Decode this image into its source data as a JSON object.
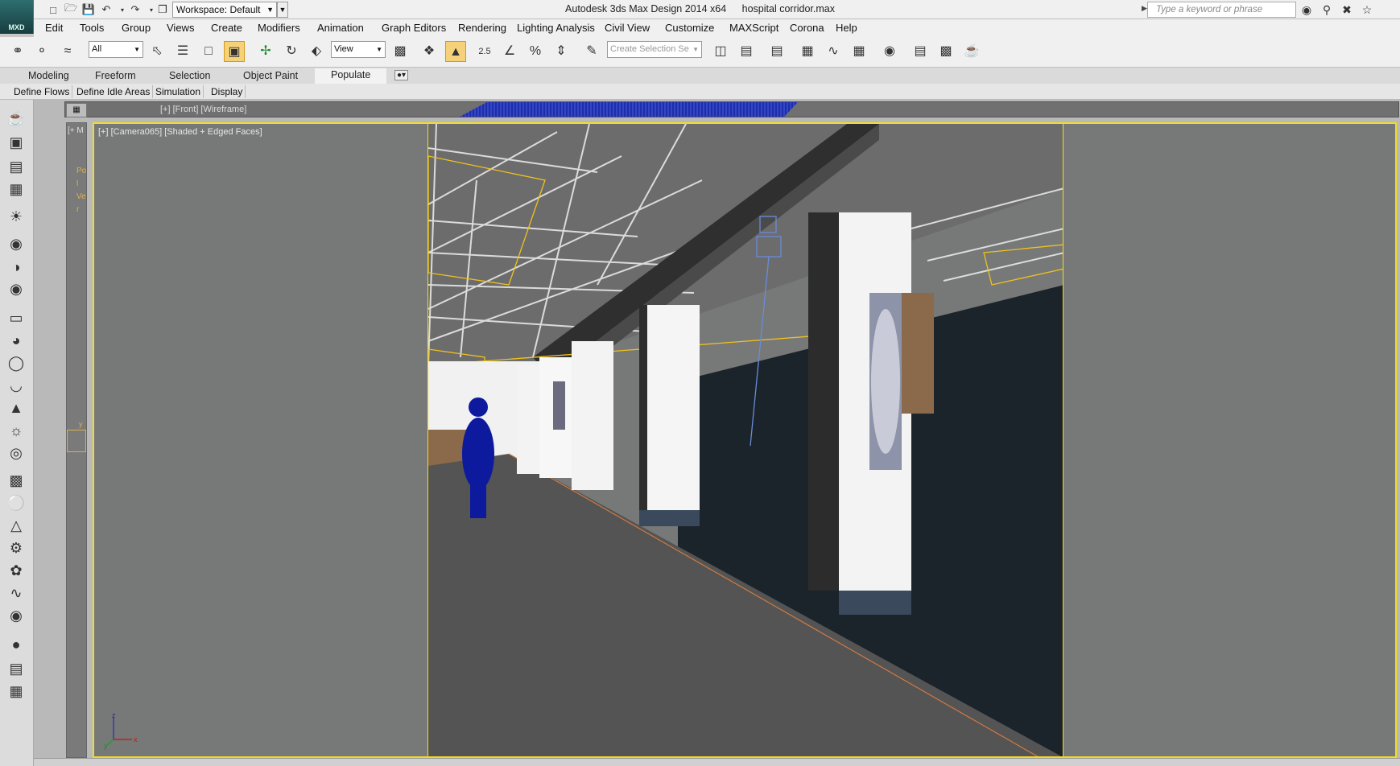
{
  "app": {
    "logo_text": "MXD",
    "title_app": "Autodesk 3ds Max Design 2014 x64",
    "title_file": "hospital corridor.max",
    "workspace_label": "Workspace: Default",
    "search_placeholder": "Type a keyword or phrase"
  },
  "quick_access_icons": [
    "new-file-icon",
    "open-file-icon",
    "save-icon",
    "undo-icon",
    "redo-icon",
    "project-folder-icon"
  ],
  "help_icons": [
    "binoculars-icon",
    "keys-icon",
    "communication-icon",
    "favorites-star-icon"
  ],
  "menus": [
    "Edit",
    "Tools",
    "Group",
    "Views",
    "Create",
    "Modifiers",
    "Animation",
    "Graph Editors",
    "Rendering",
    "Lighting Analysis",
    "Civil View",
    "Customize",
    "MAXScript",
    "Corona",
    "Help"
  ],
  "toolbar": {
    "filter_value": "All",
    "refcoord_value": "View",
    "selection_set_placeholder": "Create Selection Se",
    "snap_label": "2.5"
  },
  "ribbon": {
    "tabs": [
      "Modeling",
      "Freeform",
      "Selection",
      "Object Paint",
      "Populate"
    ],
    "active_tab": "Populate",
    "panel_buttons": [
      "Define Flows",
      "Define Idle Areas",
      "Simulation",
      "Display"
    ]
  },
  "viewports": {
    "front_label": "[+] [Front] [Wireframe]",
    "left_label": "[+ M",
    "left_side_text": "Pol Ver",
    "left_axis": "y",
    "camera_label": "[+] [Camera065] [Shaded + Edged Faces]",
    "gizmo_axes": {
      "z": "z",
      "y": "y",
      "x": "x"
    }
  },
  "colors": {
    "active_border": "#f1dc22",
    "viewport_bg": "#777878",
    "accent_wire": "#f0c21e"
  }
}
